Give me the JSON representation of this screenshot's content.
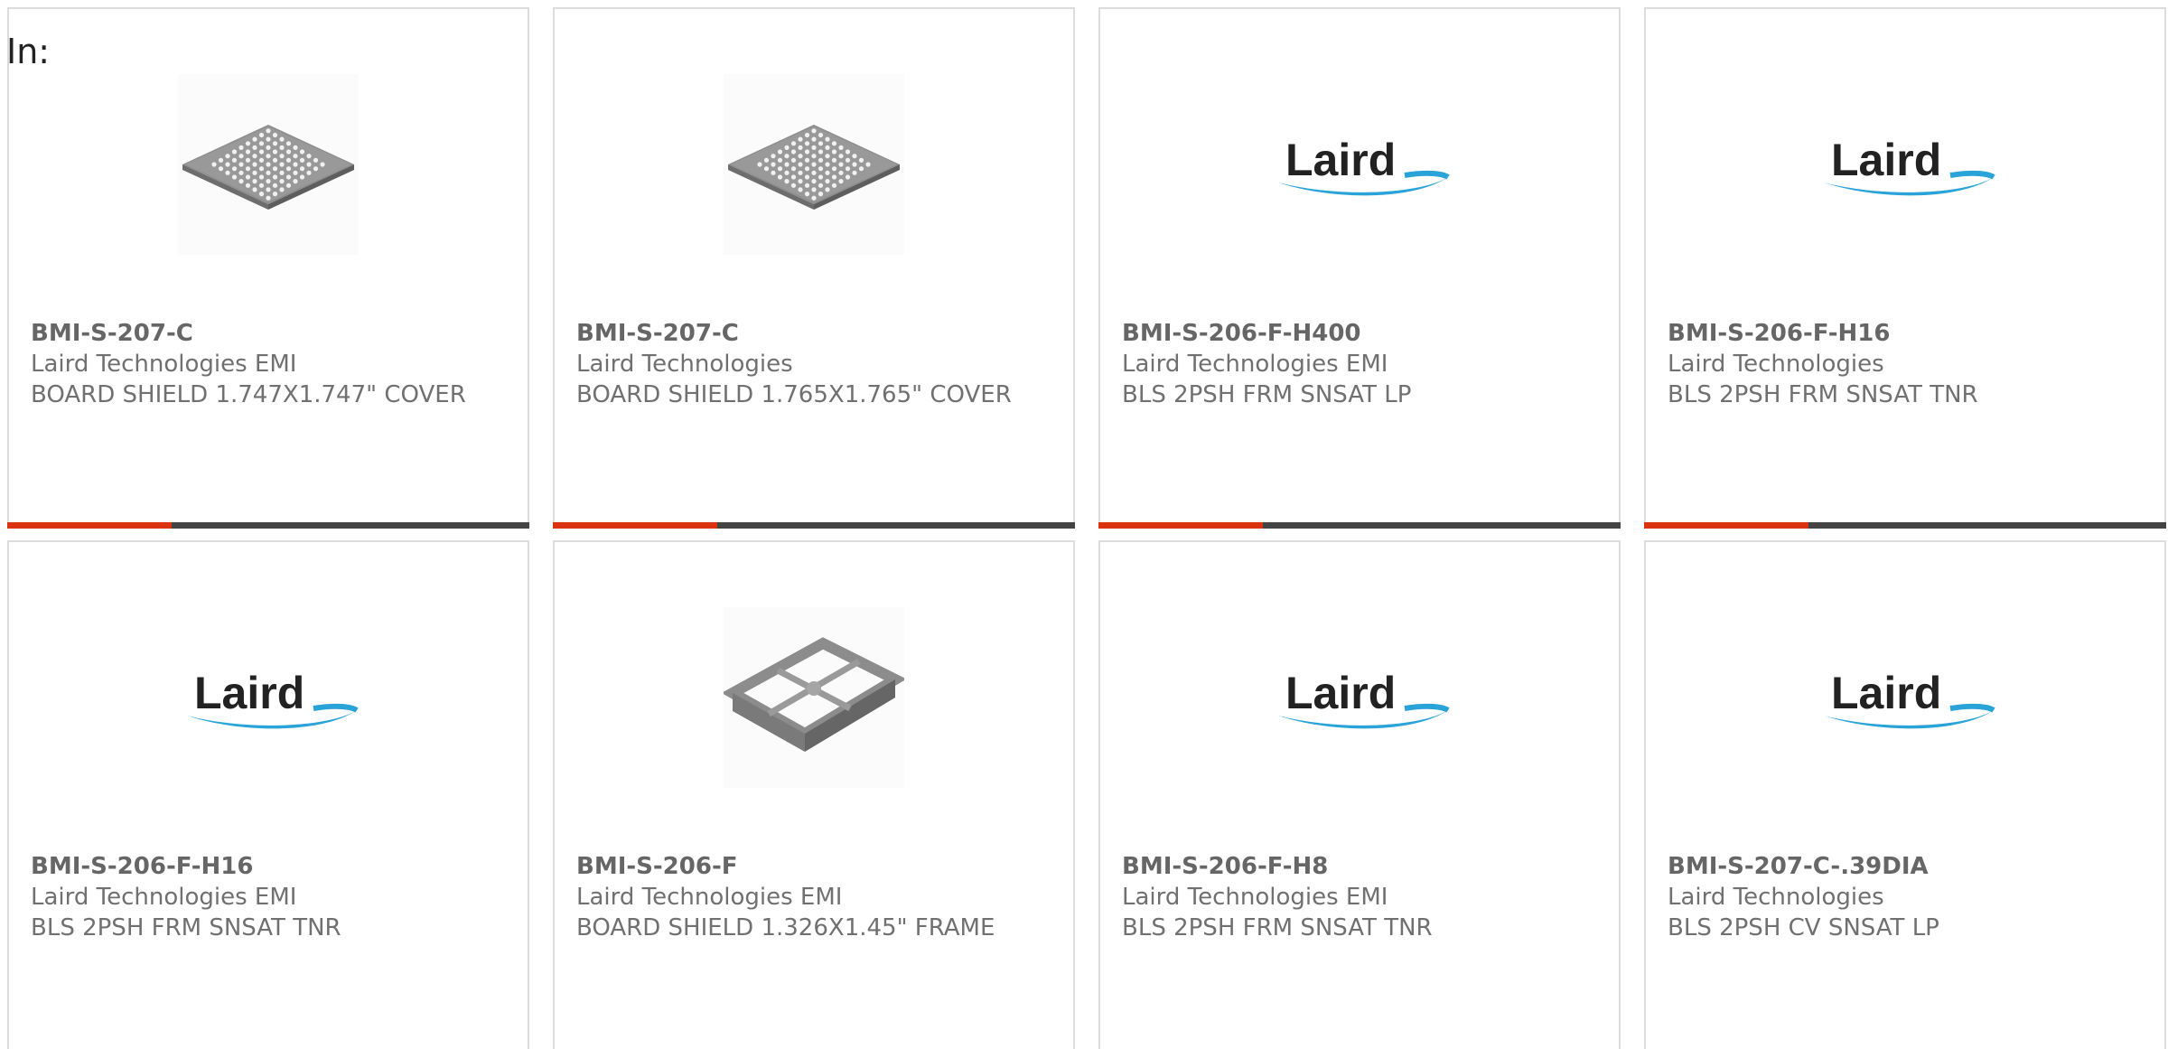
{
  "header": {
    "label": "In:"
  },
  "brand": {
    "logo_text": "Laird",
    "accent_color": "#d9340f",
    "bar_color": "#444444",
    "swoosh_color": "#29a3d8"
  },
  "products": [
    {
      "part_number": "BMI-S-207-C",
      "manufacturer": "Laird Technologies EMI",
      "description": "BOARD SHIELD 1.747X1.747\" COVER",
      "image": "shield-cover-icon"
    },
    {
      "part_number": "BMI-S-207-C",
      "manufacturer": "Laird Technologies",
      "description": "BOARD SHIELD 1.765X1.765\" COVER",
      "image": "shield-cover-icon"
    },
    {
      "part_number": "BMI-S-206-F-H400",
      "manufacturer": "Laird Technologies EMI",
      "description": "BLS 2PSH FRM SNSAT LP",
      "image": "laird-logo"
    },
    {
      "part_number": "BMI-S-206-F-H16",
      "manufacturer": "Laird Technologies",
      "description": "BLS 2PSH FRM SNSAT TNR",
      "image": "laird-logo"
    },
    {
      "part_number": "BMI-S-206-F-H16",
      "manufacturer": "Laird Technologies EMI",
      "description": "BLS 2PSH FRM SNSAT TNR",
      "image": "laird-logo"
    },
    {
      "part_number": "BMI-S-206-F",
      "manufacturer": "Laird Technologies EMI",
      "description": "BOARD SHIELD 1.326X1.45\" FRAME",
      "image": "shield-frame-icon"
    },
    {
      "part_number": "BMI-S-206-F-H8",
      "manufacturer": "Laird Technologies EMI",
      "description": "BLS 2PSH FRM SNSAT TNR",
      "image": "laird-logo"
    },
    {
      "part_number": "BMI-S-207-C-.39DIA",
      "manufacturer": "Laird Technologies",
      "description": "BLS 2PSH CV SNSAT LP",
      "image": "laird-logo"
    }
  ]
}
